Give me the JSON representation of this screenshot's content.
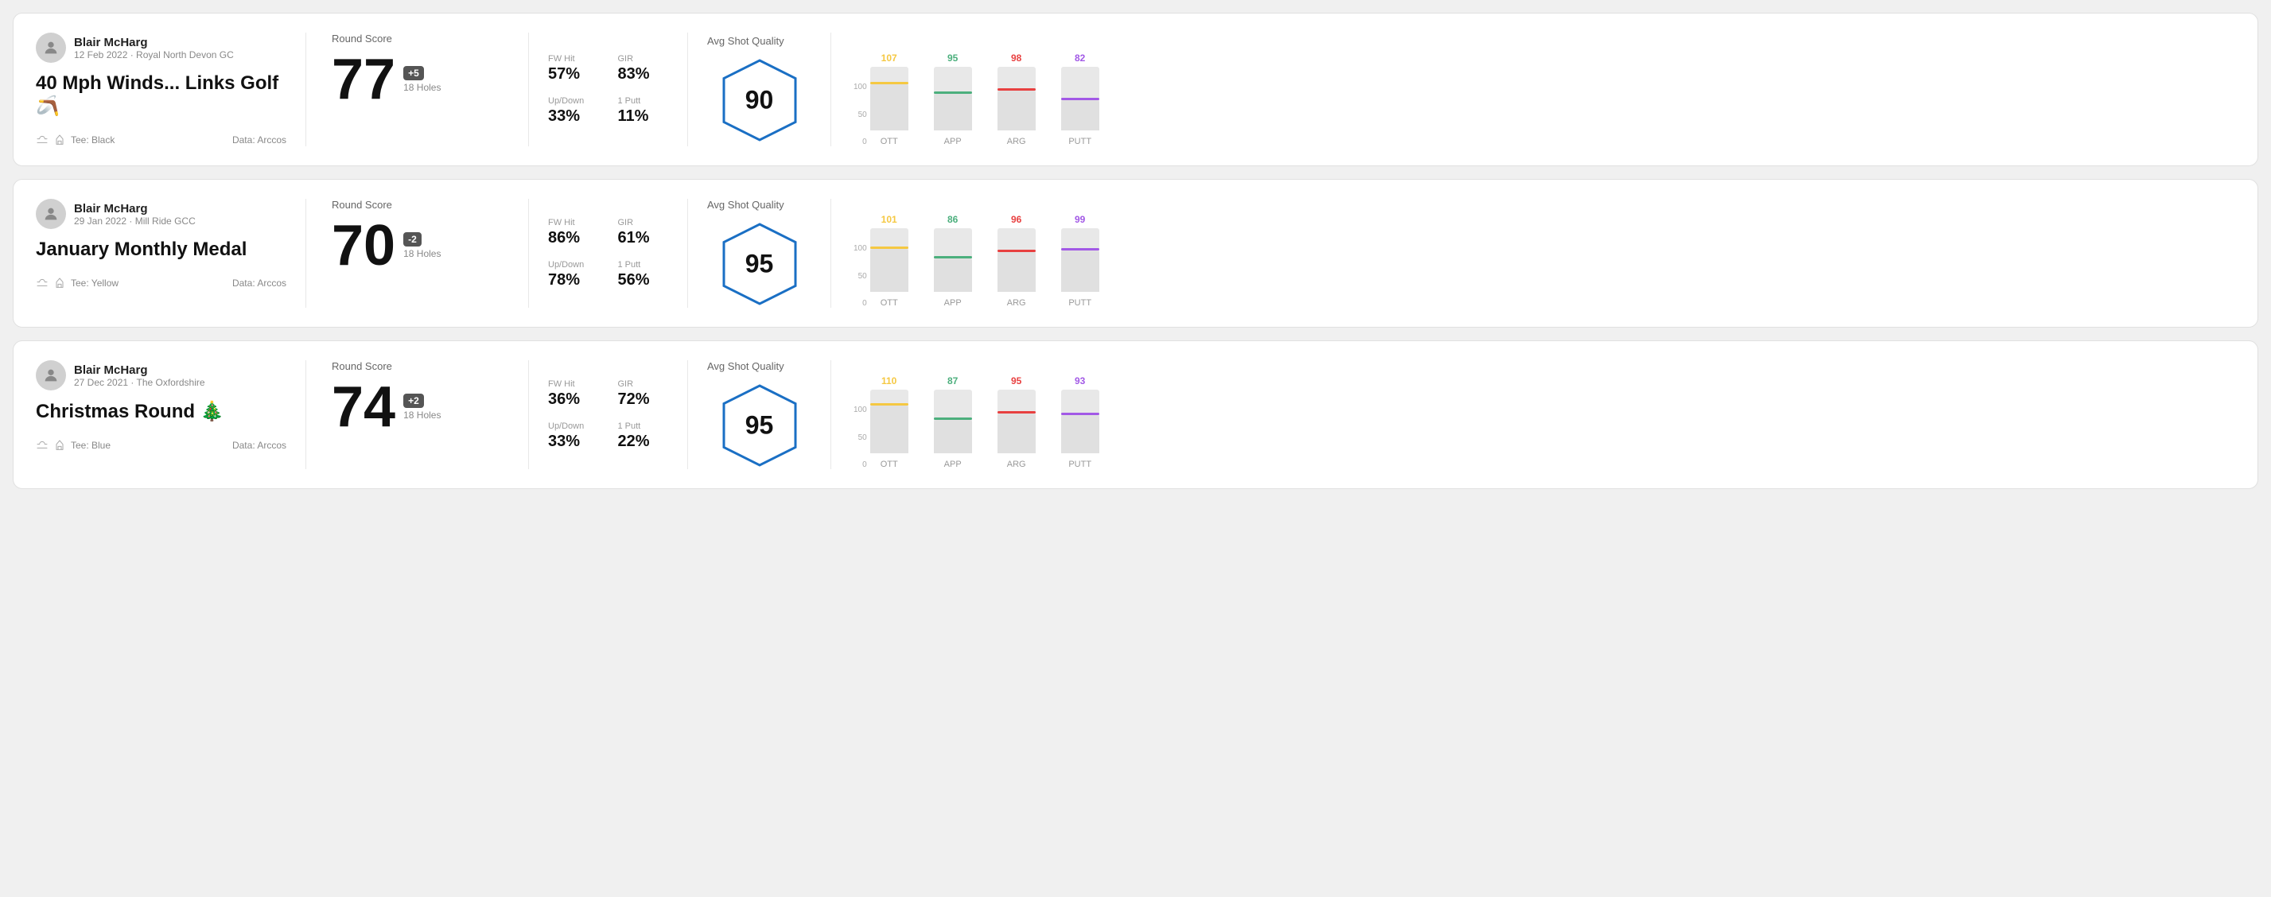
{
  "rounds": [
    {
      "id": "round-1",
      "user": {
        "name": "Blair McHarg",
        "date": "12 Feb 2022 · Royal North Devon GC",
        "tee": "Black",
        "data_source": "Data: Arccos"
      },
      "title": "40 Mph Winds... Links Golf 🪃",
      "score": {
        "value": "77",
        "badge": "+5",
        "holes": "18 Holes",
        "label": "Round Score"
      },
      "stats": {
        "fw_hit_label": "FW Hit",
        "fw_hit_value": "57%",
        "gir_label": "GIR",
        "gir_value": "83%",
        "updown_label": "Up/Down",
        "updown_value": "33%",
        "oneputt_label": "1 Putt",
        "oneputt_value": "11%"
      },
      "quality": {
        "label": "Avg Shot Quality",
        "score": "90"
      },
      "chart": {
        "bars": [
          {
            "label": "OTT",
            "value": 107,
            "color": "#f5c842",
            "fill_pct": 72
          },
          {
            "label": "APP",
            "value": 95,
            "color": "#4caf7d",
            "fill_pct": 58
          },
          {
            "label": "ARG",
            "value": 98,
            "color": "#e84040",
            "fill_pct": 62
          },
          {
            "label": "PUTT",
            "value": 82,
            "color": "#a259e6",
            "fill_pct": 48
          }
        ],
        "y_labels": [
          "100",
          "50",
          "0"
        ]
      }
    },
    {
      "id": "round-2",
      "user": {
        "name": "Blair McHarg",
        "date": "29 Jan 2022 · Mill Ride GCC",
        "tee": "Yellow",
        "data_source": "Data: Arccos"
      },
      "title": "January Monthly Medal",
      "score": {
        "value": "70",
        "badge": "-2",
        "holes": "18 Holes",
        "label": "Round Score"
      },
      "stats": {
        "fw_hit_label": "FW Hit",
        "fw_hit_value": "86%",
        "gir_label": "GIR",
        "gir_value": "61%",
        "updown_label": "Up/Down",
        "updown_value": "78%",
        "oneputt_label": "1 Putt",
        "oneputt_value": "56%"
      },
      "quality": {
        "label": "Avg Shot Quality",
        "score": "95"
      },
      "chart": {
        "bars": [
          {
            "label": "OTT",
            "value": 101,
            "color": "#f5c842",
            "fill_pct": 68
          },
          {
            "label": "APP",
            "value": 86,
            "color": "#4caf7d",
            "fill_pct": 52
          },
          {
            "label": "ARG",
            "value": 96,
            "color": "#e84040",
            "fill_pct": 62
          },
          {
            "label": "PUTT",
            "value": 99,
            "color": "#a259e6",
            "fill_pct": 65
          }
        ],
        "y_labels": [
          "100",
          "50",
          "0"
        ]
      }
    },
    {
      "id": "round-3",
      "user": {
        "name": "Blair McHarg",
        "date": "27 Dec 2021 · The Oxfordshire",
        "tee": "Blue",
        "data_source": "Data: Arccos"
      },
      "title": "Christmas Round 🎄",
      "score": {
        "value": "74",
        "badge": "+2",
        "holes": "18 Holes",
        "label": "Round Score"
      },
      "stats": {
        "fw_hit_label": "FW Hit",
        "fw_hit_value": "36%",
        "gir_label": "GIR",
        "gir_value": "72%",
        "updown_label": "Up/Down",
        "updown_value": "33%",
        "oneputt_label": "1 Putt",
        "oneputt_value": "22%"
      },
      "quality": {
        "label": "Avg Shot Quality",
        "score": "95"
      },
      "chart": {
        "bars": [
          {
            "label": "OTT",
            "value": 110,
            "color": "#f5c842",
            "fill_pct": 75
          },
          {
            "label": "APP",
            "value": 87,
            "color": "#4caf7d",
            "fill_pct": 53
          },
          {
            "label": "ARG",
            "value": 95,
            "color": "#e84040",
            "fill_pct": 62
          },
          {
            "label": "PUTT",
            "value": 93,
            "color": "#a259e6",
            "fill_pct": 60
          }
        ],
        "y_labels": [
          "100",
          "50",
          "0"
        ]
      }
    }
  ]
}
